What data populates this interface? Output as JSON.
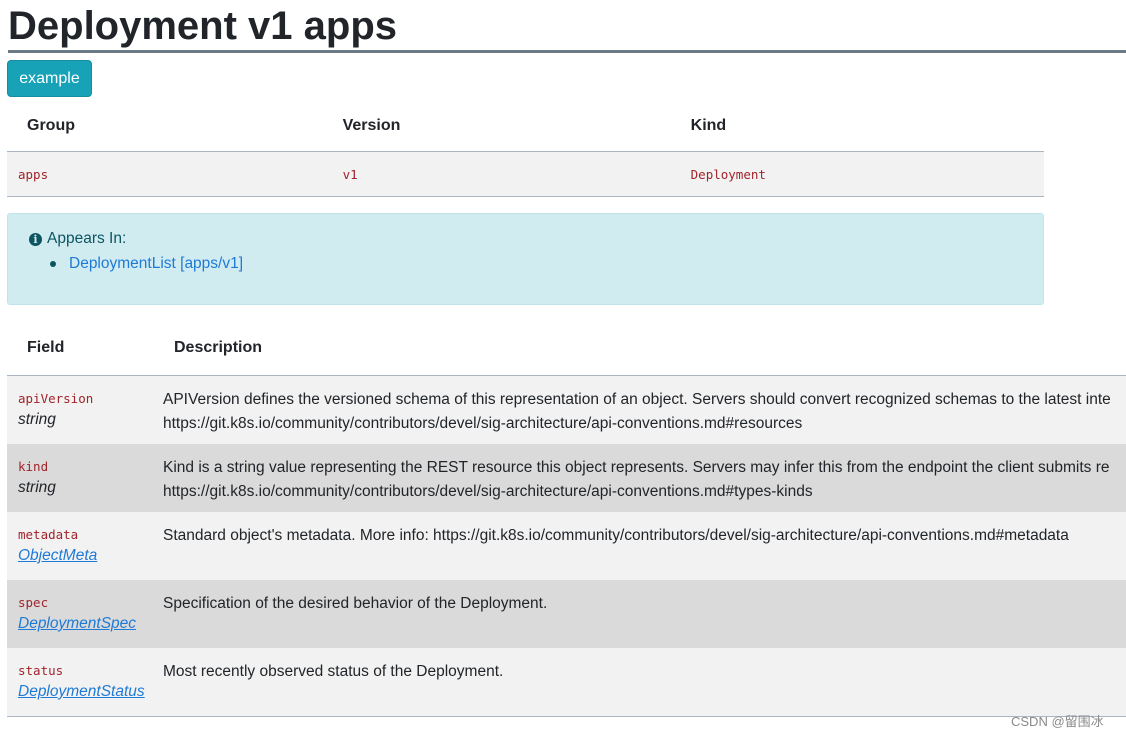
{
  "page": {
    "title": "Deployment v1 apps",
    "example_button": "example"
  },
  "gvk_table": {
    "headers": [
      "Group",
      "Version",
      "Kind"
    ],
    "row": [
      "apps",
      "v1",
      "Deployment"
    ]
  },
  "appears_in": {
    "label": "Appears In:",
    "items": [
      "DeploymentList [apps/v1]"
    ]
  },
  "fields_table": {
    "headers": [
      "Field",
      "Description"
    ],
    "rows": [
      {
        "name": "apiVersion",
        "type": "string",
        "type_is_link": false,
        "desc_line1": "APIVersion defines the versioned schema of this representation of an object. Servers should convert recognized schemas to the latest inte",
        "desc_line2": "https://git.k8s.io/community/contributors/devel/sig-architecture/api-conventions.md#resources"
      },
      {
        "name": "kind",
        "type": "string",
        "type_is_link": false,
        "desc_line1": "Kind is a string value representing the REST resource this object represents. Servers may infer this from the endpoint the client submits re",
        "desc_line2": "https://git.k8s.io/community/contributors/devel/sig-architecture/api-conventions.md#types-kinds"
      },
      {
        "name": "metadata",
        "type": "ObjectMeta",
        "type_is_link": true,
        "desc_line1": "Standard object's metadata. More info: https://git.k8s.io/community/contributors/devel/sig-architecture/api-conventions.md#metadata",
        "desc_line2": ""
      },
      {
        "name": "spec",
        "type": "DeploymentSpec",
        "type_is_link": true,
        "desc_line1": "Specification of the desired behavior of the Deployment.",
        "desc_line2": ""
      },
      {
        "name": "status",
        "type": "DeploymentStatus",
        "type_is_link": true,
        "desc_line1": "Most recently observed status of the Deployment.",
        "desc_line2": ""
      }
    ]
  },
  "watermark": "CSDN @留围冰",
  "colors": {
    "button": "#17a2b8",
    "alert_bg": "#d1ecf1",
    "link": "#1e7ad6",
    "code": "#a0242b",
    "row_odd": "#f2f2f2",
    "row_even": "#dadada"
  },
  "icons": {
    "alert": "info-circle-icon",
    "list": "bullet-icon"
  }
}
